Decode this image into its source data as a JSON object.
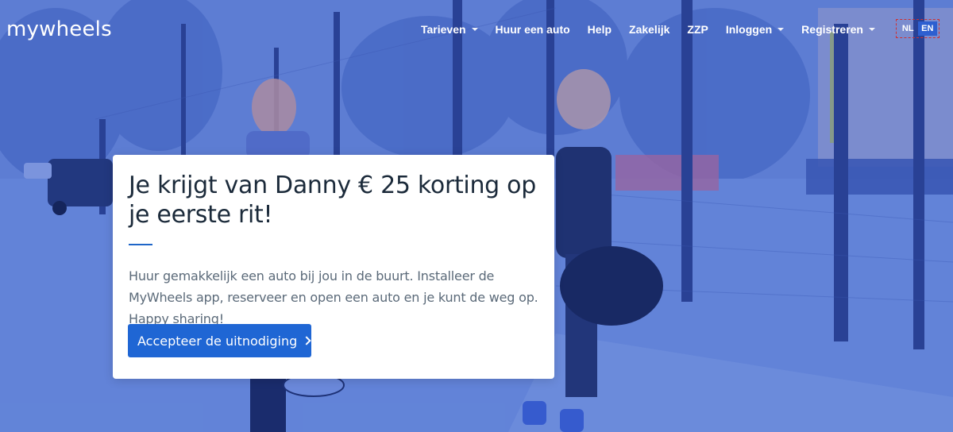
{
  "header": {
    "logo": "mywheels",
    "nav": [
      {
        "label": "Tarieven",
        "dropdown": true
      },
      {
        "label": "Huur een auto",
        "dropdown": false
      },
      {
        "label": "Help",
        "dropdown": false
      },
      {
        "label": "Zakelijk",
        "dropdown": false
      },
      {
        "label": "ZZP",
        "dropdown": false
      },
      {
        "label": "Inloggen",
        "dropdown": true
      },
      {
        "label": "Registreren",
        "dropdown": true
      }
    ],
    "languages": {
      "nl": "NL",
      "en": "EN",
      "active": "EN"
    }
  },
  "card": {
    "title": "Je krijgt van Danny € 25 korting op je eerste rit!",
    "text": "Huur gemakkelijk een auto bij jou in de buurt. Installeer de MyWheels app, reserveer en open een auto en je kunt de weg op. Happy sharing!",
    "button_label": "Accepteer de uitnodiging"
  },
  "colors": {
    "accent": "#1f66d4",
    "background_tint": "#5d7fd8",
    "title": "#1b2a3a",
    "body_text": "#5b6a79"
  }
}
